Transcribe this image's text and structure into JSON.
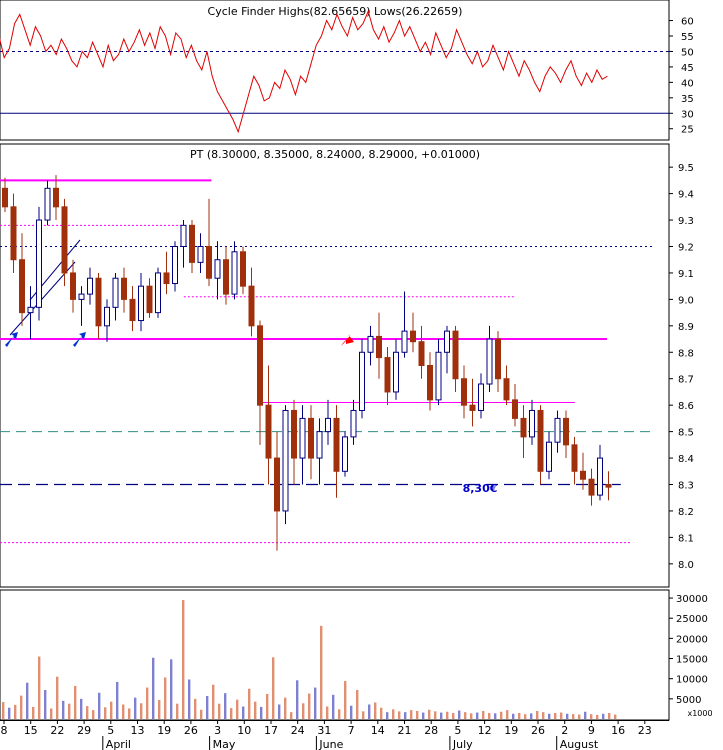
{
  "colors": {
    "up_candle": "#000080",
    "down_candle": "#a0300c",
    "magenta": "#ff00ff",
    "indicator_line": "#e00000",
    "vol_down": "#e09070",
    "vol_up": "#8080d0",
    "blue_arrow": "#0033cc",
    "red_arrow": "#ff0000",
    "grid": "#000080",
    "teal": "#2f8f83"
  },
  "chart_data": [
    {
      "type": "line",
      "panel": "indicator",
      "title": "Cycle Finder Highs(82.65659) Lows(26.22659)",
      "y_ticks": [
        "25",
        "30",
        "35",
        "40",
        "45",
        "50",
        "55",
        "60"
      ],
      "ylim": [
        22,
        66
      ],
      "reference_lines": [
        30,
        50
      ],
      "x": [
        0,
        1,
        2,
        3,
        4,
        5,
        6,
        7,
        8,
        9,
        10,
        11,
        12,
        13,
        14,
        15,
        16,
        17,
        18,
        19,
        20,
        21,
        22,
        23,
        24,
        25,
        26,
        27,
        28,
        29,
        30,
        31,
        32,
        33,
        34,
        35,
        36,
        37,
        38,
        39,
        40,
        41,
        42,
        43,
        44,
        45,
        46,
        47,
        48,
        49,
        50,
        51,
        52,
        53,
        54,
        55,
        56,
        57,
        58,
        59,
        60,
        61,
        62,
        63,
        64,
        65,
        66,
        67,
        68,
        69,
        70,
        71,
        72,
        73,
        74,
        75,
        76,
        77,
        78,
        79,
        80,
        81,
        82,
        83,
        84,
        85,
        86,
        87,
        88,
        89,
        90,
        91,
        92,
        93,
        94,
        95,
        96,
        97,
        98,
        99,
        100,
        101,
        102,
        103,
        104,
        105,
        106,
        107,
        108,
        109,
        110,
        111,
        112,
        113,
        114,
        115,
        116,
        117
      ],
      "values": [
        55,
        48,
        51,
        59,
        62,
        57,
        52,
        58,
        55,
        50,
        52,
        49,
        54,
        51,
        47,
        45,
        50,
        48,
        53,
        49,
        45,
        52,
        47,
        49,
        54,
        50,
        53,
        57,
        52,
        56,
        51,
        58,
        55,
        49,
        56,
        54,
        48,
        52,
        47,
        44,
        50,
        42,
        37,
        34,
        31,
        28,
        24,
        30,
        36,
        42,
        39,
        34,
        35,
        40,
        38,
        44,
        41,
        36,
        42,
        40,
        46,
        52,
        55,
        60,
        57,
        62,
        58,
        55,
        61,
        57,
        59,
        63,
        57,
        54,
        58,
        53,
        56,
        60,
        55,
        58,
        54,
        50,
        53,
        49,
        56,
        52,
        48,
        51,
        57,
        53,
        49,
        46,
        50,
        45,
        47,
        52,
        48,
        44,
        50,
        46,
        42,
        47,
        44,
        40,
        37,
        42,
        45,
        43,
        40,
        44,
        47,
        42,
        39,
        43,
        40,
        44,
        41,
        42
      ]
    },
    {
      "type": "candlestick",
      "panel": "price",
      "title": "PT (8.30000, 8.35000, 8.24000, 8.29000, +0.01000)",
      "y_ticks": [
        "8.0",
        "8.1",
        "8.2",
        "8.3",
        "8.4",
        "8.5",
        "8.6",
        "8.7",
        "8.8",
        "8.9",
        "9.0",
        "9.1",
        "9.2",
        "9.3",
        "9.4",
        "9.5"
      ],
      "ylim": [
        7.92,
        9.58
      ],
      "annotation": "8,30€",
      "support_resistance": [
        {
          "price": 9.45,
          "style": "magenta",
          "from": -3,
          "to": 44
        },
        {
          "price": 8.85,
          "style": "magenta",
          "from": -3,
          "to": 130
        },
        {
          "price": 8.61,
          "style": "magenta_thin",
          "from": 55,
          "to": 123
        },
        {
          "price": 9.28,
          "style": "dotted",
          "from": -3,
          "to": 38
        },
        {
          "price": 9.01,
          "style": "dotted",
          "from": 38,
          "to": 110
        },
        {
          "price": 8.08,
          "style": "dotted",
          "from": -3,
          "to": 135
        },
        {
          "price": 9.2,
          "style": "grid_dotted",
          "from": -3,
          "to": 140
        },
        {
          "price": 8.5,
          "style": "teal_dash",
          "from": -3,
          "to": 140
        },
        {
          "price": 8.3,
          "style": "navy_dash",
          "from": -3,
          "to": 133
        }
      ],
      "candles": [
        [
          9.42,
          9.46,
          9.33,
          9.35
        ],
        [
          9.35,
          9.4,
          9.1,
          9.15
        ],
        [
          9.15,
          9.25,
          8.9,
          8.95
        ],
        [
          8.95,
          9.05,
          8.85,
          8.97
        ],
        [
          8.97,
          9.35,
          8.92,
          9.3
        ],
        [
          9.3,
          9.45,
          9.28,
          9.42
        ],
        [
          9.42,
          9.47,
          9.3,
          9.35
        ],
        [
          9.35,
          9.38,
          9.05,
          9.1
        ],
        [
          9.1,
          9.15,
          8.95,
          9.0
        ],
        [
          9.0,
          9.05,
          8.9,
          9.02
        ],
        [
          9.02,
          9.12,
          8.98,
          9.08
        ],
        [
          9.08,
          9.1,
          8.85,
          8.9
        ],
        [
          8.9,
          9.0,
          8.84,
          8.97
        ],
        [
          8.97,
          9.1,
          8.92,
          9.08
        ],
        [
          9.08,
          9.12,
          8.95,
          9.0
        ],
        [
          9.0,
          9.05,
          8.88,
          8.92
        ],
        [
          8.92,
          9.1,
          8.88,
          9.05
        ],
        [
          9.05,
          9.08,
          8.93,
          8.95
        ],
        [
          8.95,
          9.12,
          8.93,
          9.1
        ],
        [
          9.1,
          9.18,
          9.02,
          9.06
        ],
        [
          9.06,
          9.22,
          9.03,
          9.2
        ],
        [
          9.2,
          9.3,
          9.12,
          9.28
        ],
        [
          9.28,
          9.3,
          9.1,
          9.14
        ],
        [
          9.14,
          9.25,
          9.1,
          9.2
        ],
        [
          9.2,
          9.38,
          9.05,
          9.08
        ],
        [
          9.08,
          9.22,
          9.0,
          9.15
        ],
        [
          9.15,
          9.2,
          8.98,
          9.02
        ],
        [
          9.02,
          9.22,
          9.0,
          9.18
        ],
        [
          9.18,
          9.2,
          9.02,
          9.05
        ],
        [
          9.05,
          9.12,
          8.86,
          8.9
        ],
        [
          8.9,
          8.92,
          8.45,
          8.6
        ],
        [
          8.6,
          8.75,
          8.3,
          8.4
        ],
        [
          8.4,
          8.5,
          8.05,
          8.2
        ],
        [
          8.2,
          8.6,
          8.15,
          8.58
        ],
        [
          8.58,
          8.62,
          8.3,
          8.4
        ],
        [
          8.4,
          8.6,
          8.3,
          8.55
        ],
        [
          8.55,
          8.6,
          8.32,
          8.4
        ],
        [
          8.4,
          8.55,
          8.3,
          8.5
        ],
        [
          8.5,
          8.62,
          8.45,
          8.55
        ],
        [
          8.55,
          8.6,
          8.25,
          8.35
        ],
        [
          8.35,
          8.5,
          8.33,
          8.48
        ],
        [
          8.48,
          8.62,
          8.45,
          8.58
        ],
        [
          8.58,
          8.85,
          8.55,
          8.8
        ],
        [
          8.8,
          8.9,
          8.75,
          8.86
        ],
        [
          8.86,
          8.95,
          8.7,
          8.78
        ],
        [
          8.78,
          8.82,
          8.6,
          8.65
        ],
        [
          8.65,
          8.85,
          8.62,
          8.8
        ],
        [
          8.8,
          9.03,
          8.78,
          8.88
        ],
        [
          8.88,
          8.95,
          8.8,
          8.84
        ],
        [
          8.84,
          8.9,
          8.7,
          8.75
        ],
        [
          8.75,
          8.8,
          8.58,
          8.62
        ],
        [
          8.62,
          8.85,
          8.6,
          8.8
        ],
        [
          8.8,
          8.9,
          8.72,
          8.88
        ],
        [
          8.88,
          8.9,
          8.65,
          8.7
        ],
        [
          8.7,
          8.75,
          8.55,
          8.6
        ],
        [
          8.6,
          8.7,
          8.52,
          8.58
        ],
        [
          8.58,
          8.72,
          8.55,
          8.68
        ],
        [
          8.68,
          8.9,
          8.65,
          8.85
        ],
        [
          8.85,
          8.88,
          8.65,
          8.7
        ],
        [
          8.7,
          8.75,
          8.6,
          8.62
        ],
        [
          8.62,
          8.68,
          8.52,
          8.55
        ],
        [
          8.55,
          8.6,
          8.4,
          8.48
        ],
        [
          8.48,
          8.62,
          8.45,
          8.58
        ],
        [
          8.58,
          8.6,
          8.3,
          8.35
        ],
        [
          8.35,
          8.5,
          8.32,
          8.46
        ],
        [
          8.46,
          8.58,
          8.42,
          8.55
        ],
        [
          8.55,
          8.58,
          8.4,
          8.45
        ],
        [
          8.45,
          8.48,
          8.3,
          8.35
        ],
        [
          8.35,
          8.42,
          8.28,
          8.32
        ],
        [
          8.32,
          8.36,
          8.22,
          8.26
        ],
        [
          8.26,
          8.45,
          8.24,
          8.4
        ],
        [
          8.3,
          8.35,
          8.24,
          8.29
        ]
      ]
    },
    {
      "type": "bar",
      "panel": "volume",
      "y_ticks": [
        "5000",
        "10000",
        "15000",
        "20000",
        "25000",
        "30000"
      ],
      "ylim": [
        0,
        31500
      ],
      "unit_label": "x1000",
      "x_tick_labels": [
        "8",
        "15",
        "22",
        "29",
        "5",
        "13",
        "19",
        "26",
        "3",
        "10",
        "17",
        "24",
        "31",
        "7",
        "14",
        "21",
        "28",
        "5",
        "12",
        "19",
        "26",
        "2",
        "9",
        "16",
        "23"
      ],
      "month_labels": [
        "April",
        "May",
        "June",
        "July",
        "August"
      ],
      "values": [
        4200,
        2800,
        3500,
        5800,
        9000,
        3000,
        15500,
        7200,
        2600,
        10500,
        4500,
        3800,
        8200,
        5000,
        3200,
        2200,
        6500,
        2900,
        4300,
        9200,
        3600,
        2600,
        5300,
        3900,
        7800,
        15200,
        4700,
        10300,
        14800,
        3800,
        29500,
        9800,
        5000,
        2300,
        5700,
        8500,
        3800,
        6400,
        2700,
        4800,
        3100,
        7500,
        4300,
        3000,
        6200,
        15300,
        3600,
        5300,
        1700,
        9600,
        3900,
        6300,
        7800,
        23100,
        3100,
        6000,
        2400,
        9400,
        3300,
        7200,
        1900,
        3600,
        4100,
        2800,
        1700,
        2400,
        1900,
        1700,
        2200,
        2000,
        1600,
        2300,
        1900,
        1600,
        1800,
        1500,
        2100,
        1700,
        1400,
        1600,
        2000,
        1500,
        1400,
        1800,
        2200,
        1300,
        1500,
        1200,
        1400,
        2000,
        1700,
        1300,
        1500,
        1600,
        1300,
        1200,
        1100,
        1800,
        1200,
        1000,
        1300,
        1500,
        1100
      ]
    }
  ]
}
